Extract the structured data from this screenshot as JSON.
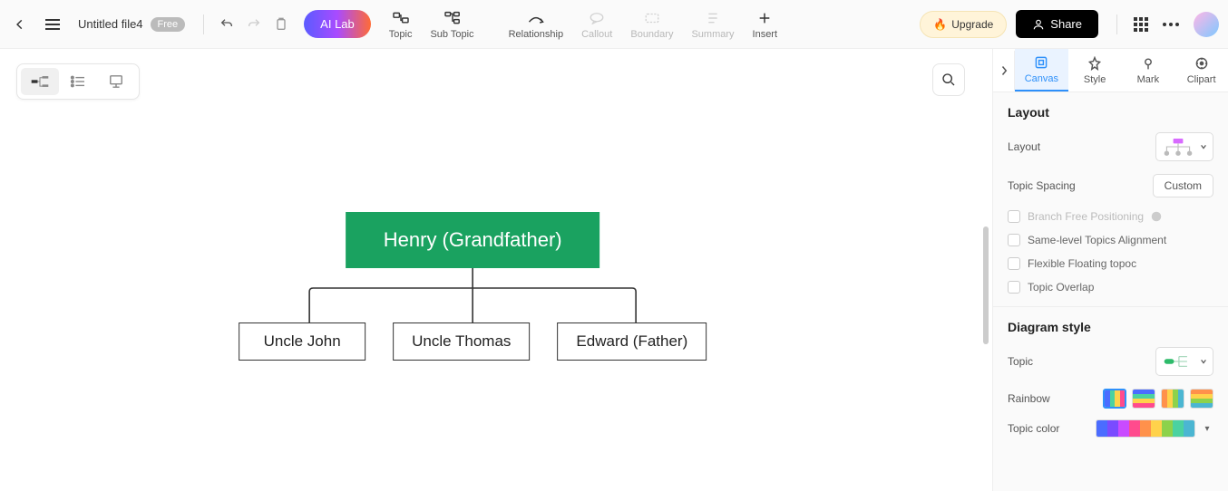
{
  "header": {
    "file_name": "Untitled file4",
    "badge": "Free",
    "ai_lab": "AI Lab",
    "tools": {
      "topic": "Topic",
      "subtopic": "Sub Topic",
      "relationship": "Relationship",
      "callout": "Callout",
      "boundary": "Boundary",
      "summary": "Summary",
      "insert": "Insert"
    },
    "upgrade": "Upgrade",
    "share": "Share"
  },
  "diagram": {
    "root": "Henry (Grandfather)",
    "children": [
      "Uncle John",
      "Uncle Thomas",
      "Edward (Father)"
    ]
  },
  "side": {
    "tabs": {
      "canvas": "Canvas",
      "style": "Style",
      "mark": "Mark",
      "clipart": "Clipart"
    },
    "layout": {
      "title": "Layout",
      "layout_label": "Layout",
      "spacing_label": "Topic Spacing",
      "spacing_value": "Custom",
      "opt_branch": "Branch Free Positioning",
      "opt_align": "Same-level Topics Alignment",
      "opt_float": "Flexible Floating topoc",
      "opt_overlap": "Topic Overlap"
    },
    "diagram_style": {
      "title": "Diagram style",
      "topic_label": "Topic",
      "rainbow_label": "Rainbow",
      "topic_color_label": "Topic color",
      "palette": [
        "#4b6cff",
        "#7a4bff",
        "#c94bff",
        "#ff4b8d",
        "#ff914b",
        "#ffd24b",
        "#8dd24b",
        "#4bd2a0",
        "#4bb6d2"
      ]
    }
  }
}
